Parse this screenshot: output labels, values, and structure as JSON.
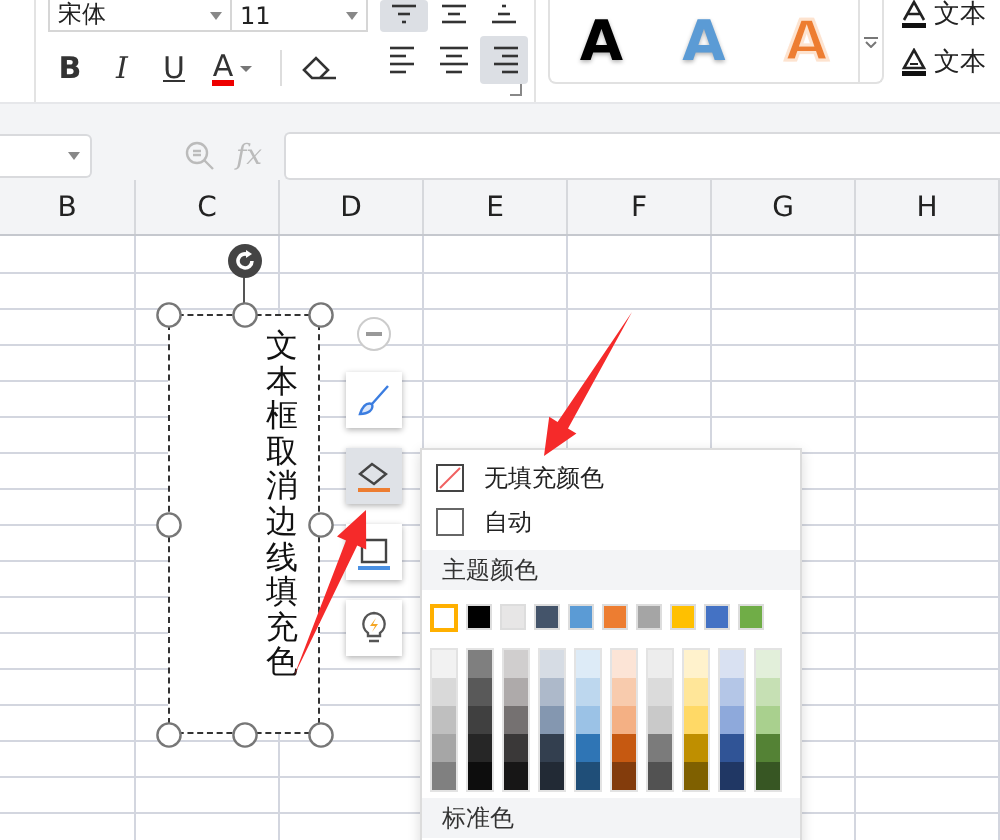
{
  "ribbon": {
    "font": {
      "name": "宋体",
      "size": "11"
    },
    "format_buttons": [
      {
        "kind": "bold",
        "label": "B"
      },
      {
        "kind": "italic",
        "label": "I"
      },
      {
        "kind": "underline",
        "label": "U"
      },
      {
        "kind": "font-color",
        "label": "A"
      }
    ],
    "align_buttons": [
      {
        "kind": "top",
        "selected": true
      },
      {
        "kind": "middle",
        "selected": false
      },
      {
        "kind": "bottom",
        "selected": false
      },
      {
        "kind": "left",
        "selected": false
      },
      {
        "kind": "center",
        "selected": false
      },
      {
        "kind": "right",
        "selected": true
      }
    ],
    "wordart_styles": [
      {
        "label": "A",
        "kind": "fill",
        "color": "#000000"
      },
      {
        "label": "A",
        "kind": "fill",
        "color": "#5b9bd5"
      },
      {
        "label": "A",
        "kind": "outline",
        "color": "#ed7d31"
      }
    ],
    "text_commands": [
      {
        "kind": "fill",
        "label": "文本"
      },
      {
        "kind": "outline",
        "label": "文本"
      }
    ]
  },
  "formula_bar": {
    "fx": "fx"
  },
  "columns": [
    "B",
    "C",
    "D",
    "E",
    "F",
    "G",
    "H"
  ],
  "text_box": {
    "text": "文本框取消边线填充色"
  },
  "float_toolbar": [
    {
      "kind": "brush",
      "selected": false
    },
    {
      "kind": "fill",
      "selected": true
    },
    {
      "kind": "border",
      "selected": false
    },
    {
      "kind": "quick",
      "selected": false
    }
  ],
  "fill_menu": {
    "items": [
      {
        "kind": "none",
        "label": "无填充颜色"
      },
      {
        "kind": "auto",
        "label": "自动"
      }
    ],
    "theme_heading": "主题颜色",
    "theme_colors": [
      {
        "color": "#ffffff",
        "selected": true
      },
      {
        "color": "#000000",
        "selected": false
      },
      {
        "color": "#e7e6e6",
        "selected": false
      },
      {
        "color": "#44546a",
        "selected": false
      },
      {
        "color": "#5b9bd5",
        "selected": false
      },
      {
        "color": "#ed7d31",
        "selected": false
      },
      {
        "color": "#a5a5a5",
        "selected": false
      },
      {
        "color": "#ffc000",
        "selected": false
      },
      {
        "color": "#4472c4",
        "selected": false
      },
      {
        "color": "#70ad47",
        "selected": false
      }
    ],
    "shade_columns": [
      {
        "shades": [
          {
            "color": "#f2f2f2"
          },
          {
            "color": "#d9d9d9"
          },
          {
            "color": "#bfbfbf"
          },
          {
            "color": "#a6a6a6"
          },
          {
            "color": "#808080"
          }
        ]
      },
      {
        "shades": [
          {
            "color": "#7f7f7f"
          },
          {
            "color": "#595959"
          },
          {
            "color": "#404040"
          },
          {
            "color": "#262626"
          },
          {
            "color": "#0d0d0d"
          }
        ]
      },
      {
        "shades": [
          {
            "color": "#d0cece"
          },
          {
            "color": "#aeaaaa"
          },
          {
            "color": "#757171"
          },
          {
            "color": "#3a3838"
          },
          {
            "color": "#171616"
          }
        ]
      },
      {
        "shades": [
          {
            "color": "#d6dce4"
          },
          {
            "color": "#adb9ca"
          },
          {
            "color": "#8497b0"
          },
          {
            "color": "#333f4f"
          },
          {
            "color": "#222a35"
          }
        ]
      },
      {
        "shades": [
          {
            "color": "#ddebf7"
          },
          {
            "color": "#bdd7ee"
          },
          {
            "color": "#9bc2e6"
          },
          {
            "color": "#2f75b5"
          },
          {
            "color": "#1f4e78"
          }
        ]
      },
      {
        "shades": [
          {
            "color": "#fce4d6"
          },
          {
            "color": "#f8cbad"
          },
          {
            "color": "#f4b084"
          },
          {
            "color": "#c65911"
          },
          {
            "color": "#833c0c"
          }
        ]
      },
      {
        "shades": [
          {
            "color": "#ededed"
          },
          {
            "color": "#dbdbdb"
          },
          {
            "color": "#c9c9c9"
          },
          {
            "color": "#7b7b7b"
          },
          {
            "color": "#525252"
          }
        ]
      },
      {
        "shades": [
          {
            "color": "#fff2cc"
          },
          {
            "color": "#ffe699"
          },
          {
            "color": "#ffd966"
          },
          {
            "color": "#bf8f00"
          },
          {
            "color": "#7f6000"
          }
        ]
      },
      {
        "shades": [
          {
            "color": "#d9e1f2"
          },
          {
            "color": "#b4c6e7"
          },
          {
            "color": "#8ea9db"
          },
          {
            "color": "#305496"
          },
          {
            "color": "#203764"
          }
        ]
      },
      {
        "shades": [
          {
            "color": "#e2efda"
          },
          {
            "color": "#c6e0b4"
          },
          {
            "color": "#a9d08e"
          },
          {
            "color": "#548235"
          },
          {
            "color": "#375623"
          }
        ]
      }
    ],
    "standard_heading": "标准色"
  }
}
